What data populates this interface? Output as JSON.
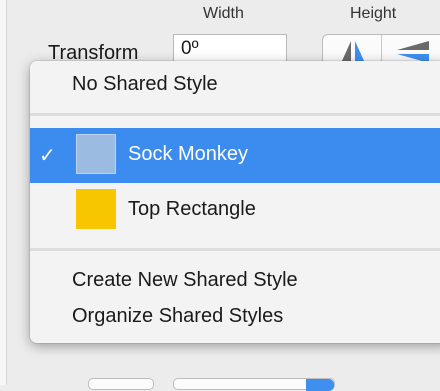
{
  "inspector": {
    "width_label": "Width",
    "height_label": "Height",
    "transform_label": "Transform",
    "rotation_value": "0º"
  },
  "menu": {
    "none_label": "No Shared Style",
    "styles": [
      {
        "name": "Sock Monkey",
        "color": "#9bbbe0",
        "selected": true
      },
      {
        "name": "Top Rectangle",
        "color": "#f7c600",
        "selected": false
      }
    ],
    "create_label": "Create New Shared Style",
    "organize_label": "Organize Shared Styles",
    "check_mark": "✓"
  },
  "colors": {
    "highlight": "#3c8cf0",
    "accent_control": "#3f8ff0"
  }
}
